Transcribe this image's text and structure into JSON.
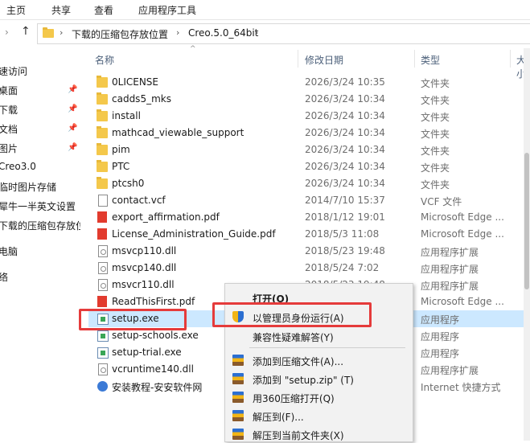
{
  "ribbon": {
    "tabs": [
      "主页",
      "共享",
      "查看",
      "应用程序工具"
    ]
  },
  "address": {
    "crumbs": [
      "下载的压缩包存放位置",
      "Creo.5.0_64bit"
    ]
  },
  "nav": {
    "items": [
      "速访问",
      "桌面",
      "下载",
      "文档",
      "图片",
      "Creo3.0",
      "临时图片存储",
      "犀牛一半英文设置",
      "下载的压缩包存放位",
      "电脑",
      "络"
    ],
    "pin_icon": "pin-icon"
  },
  "columns": {
    "name": "名称",
    "date": "修改日期",
    "type": "类型",
    "size": "大小"
  },
  "files": [
    {
      "name": "0LICENSE",
      "date": "2026/3/24 10:35",
      "type": "文件夹",
      "icon": "folder-icon"
    },
    {
      "name": "cadds5_mks",
      "date": "2026/3/24 10:34",
      "type": "文件夹",
      "icon": "folder-icon"
    },
    {
      "name": "install",
      "date": "2026/3/24 10:34",
      "type": "文件夹",
      "icon": "folder-icon"
    },
    {
      "name": "mathcad_viewable_support",
      "date": "2026/3/24 10:34",
      "type": "文件夹",
      "icon": "folder-icon"
    },
    {
      "name": "pim",
      "date": "2026/3/24 10:34",
      "type": "文件夹",
      "icon": "folder-icon"
    },
    {
      "name": "PTC",
      "date": "2026/3/24 10:34",
      "type": "文件夹",
      "icon": "folder-icon"
    },
    {
      "name": "ptcsh0",
      "date": "2026/3/24 10:34",
      "type": "文件夹",
      "icon": "folder-icon"
    },
    {
      "name": "contact.vcf",
      "date": "2014/7/10 15:37",
      "type": "VCF 文件",
      "icon": "document-icon"
    },
    {
      "name": "export_affirmation.pdf",
      "date": "2018/1/12 19:01",
      "type": "Microsoft Edge ...",
      "icon": "pdf-icon"
    },
    {
      "name": "License_Administration_Guide.pdf",
      "date": "2018/5/3 11:08",
      "type": "Microsoft Edge ...",
      "icon": "pdf-icon"
    },
    {
      "name": "msvcp110.dll",
      "date": "2018/5/23 19:48",
      "type": "应用程序扩展",
      "icon": "dll-icon"
    },
    {
      "name": "msvcp140.dll",
      "date": "2018/5/24 7:02",
      "type": "应用程序扩展",
      "icon": "dll-icon"
    },
    {
      "name": "msvcr110.dll",
      "date": "2018/5/23 19:48",
      "type": "应用程序扩展",
      "icon": "dll-icon"
    },
    {
      "name": "ReadThisFirst.pdf",
      "date": "",
      "type": "Microsoft Edge ...",
      "icon": "pdf-icon"
    },
    {
      "name": "setup.exe",
      "date": "",
      "type": "应用程序",
      "icon": "exe-icon"
    },
    {
      "name": "setup-schools.exe",
      "date": "",
      "type": "应用程序",
      "icon": "exe-icon"
    },
    {
      "name": "setup-trial.exe",
      "date": "",
      "type": "应用程序",
      "icon": "exe-icon"
    },
    {
      "name": "vcruntime140.dll",
      "date": "",
      "type": "应用程序扩展",
      "icon": "dll-icon"
    },
    {
      "name": "安装教程-安安软件网",
      "date": "",
      "type": "Internet 快捷方式",
      "icon": "internet-shortcut-icon"
    }
  ],
  "context_menu": {
    "open": "打开(O)",
    "run_as_admin": "以管理员身份运行(A)",
    "compat": "兼容性疑难解答(Y)",
    "add_archive": "添加到压缩文件(A)...",
    "add_zip": "添加到 \"setup.zip\" (T)",
    "open_360": "用360压缩打开(Q)",
    "extract_to": "解压到(F)...",
    "extract_here": "解压到当前文件夹(X)"
  },
  "colors": {
    "selection": "#cce8ff",
    "highlight_box": "#e53b3b"
  }
}
